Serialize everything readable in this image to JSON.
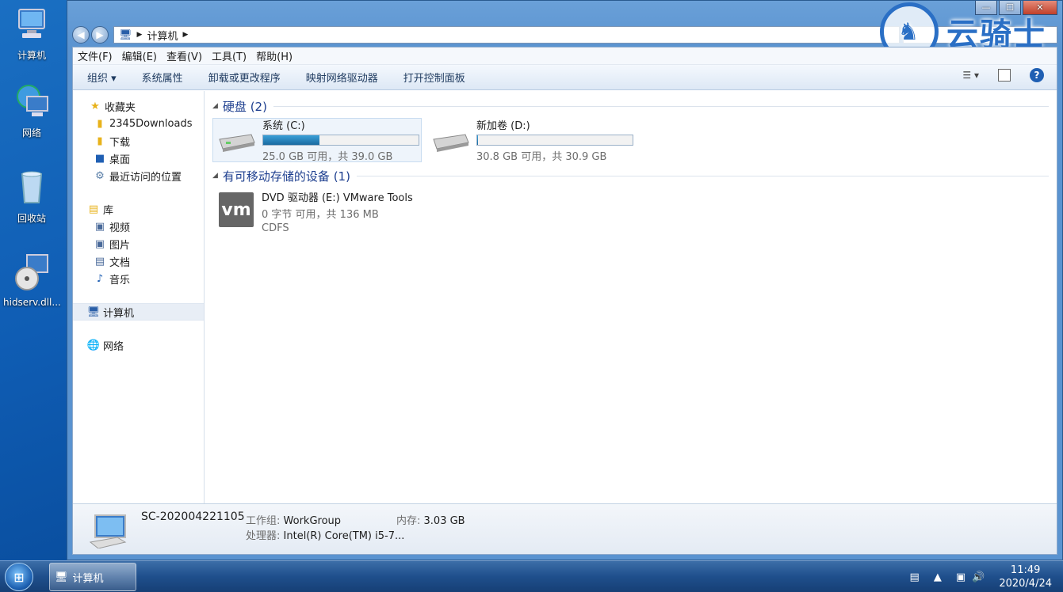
{
  "desktop": {
    "icons": [
      {
        "label": "计算机"
      },
      {
        "label": "网络"
      },
      {
        "label": "回收站"
      },
      {
        "label": "hidserv.dll..."
      }
    ]
  },
  "window": {
    "breadcrumb": [
      "计算机"
    ],
    "controls": {
      "minimize": "—",
      "maximize": "☐",
      "close": "✕"
    },
    "watermark_text": "云骑士"
  },
  "menu": [
    "文件(F)",
    "编辑(E)",
    "查看(V)",
    "工具(T)",
    "帮助(H)"
  ],
  "toolbar": [
    "组织 ▾",
    "系统属性",
    "卸载或更改程序",
    "映射网络驱动器",
    "打开控制面板"
  ],
  "nav": {
    "favorites": {
      "label": "收藏夹",
      "items": [
        "2345Downloads",
        "下载",
        "桌面",
        "最近访问的位置"
      ]
    },
    "libraries": {
      "label": "库",
      "items": [
        "视频",
        "图片",
        "文档",
        "音乐"
      ]
    },
    "computer": "计算机",
    "network": "网络"
  },
  "groups": {
    "hard_disks": {
      "header": "硬盘 (2)",
      "drives": [
        {
          "name": "系统 (C:)",
          "free_text": "25.0 GB 可用，共 39.0 GB",
          "used_fraction": 0.36
        },
        {
          "name": "新加卷 (D:)",
          "free_text": "30.8 GB 可用，共 30.9 GB",
          "used_fraction": 0.003
        }
      ]
    },
    "removable": {
      "header": "有可移动存储的设备 (1)",
      "devices": [
        {
          "icon_text": "vm",
          "name": "DVD 驱动器 (E:) VMware Tools",
          "free_text": "0 字节 可用，共 136 MB",
          "fs": "CDFS"
        }
      ]
    }
  },
  "details": {
    "name": "SC-202004221105",
    "workgroup_label": "工作组:",
    "workgroup": "WorkGroup",
    "memory_label": "内存:",
    "memory": "3.03 GB",
    "cpu_label": "处理器:",
    "cpu": "Intel(R) Core(TM) i5-7..."
  },
  "taskbar": {
    "task_label": "计算机",
    "time": "11:49",
    "date": "2020/4/24"
  },
  "colors": {
    "accent": "#1e3f8f",
    "drive_bar": "#1a6aa0"
  }
}
